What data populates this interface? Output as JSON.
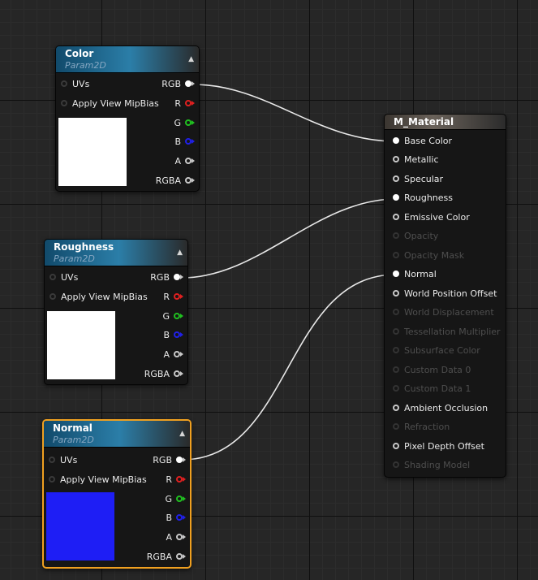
{
  "texture_nodes": [
    {
      "id": "color",
      "title": "Color",
      "subtitle": "Param2D",
      "preview_color": "#ffffff",
      "inputs": [
        "UVs",
        "Apply View MipBias"
      ],
      "outputs": [
        "RGB",
        "R",
        "G",
        "B",
        "A",
        "RGBA"
      ]
    },
    {
      "id": "roughness",
      "title": "Roughness",
      "subtitle": "Param2D",
      "preview_color": "#ffffff",
      "inputs": [
        "UVs",
        "Apply View MipBias"
      ],
      "outputs": [
        "RGB",
        "R",
        "G",
        "B",
        "A",
        "RGBA"
      ]
    },
    {
      "id": "normal",
      "title": "Normal",
      "subtitle": "Param2D",
      "preview_color": "#1e1ef5",
      "selected": true,
      "inputs": [
        "UVs",
        "Apply View MipBias"
      ],
      "outputs": [
        "RGB",
        "R",
        "G",
        "B",
        "A",
        "RGBA"
      ]
    }
  ],
  "material": {
    "title": "M_Material",
    "pins": [
      {
        "label": "Base Color",
        "enabled": true,
        "connected": true
      },
      {
        "label": "Metallic",
        "enabled": true,
        "connected": false
      },
      {
        "label": "Specular",
        "enabled": true,
        "connected": false
      },
      {
        "label": "Roughness",
        "enabled": true,
        "connected": true
      },
      {
        "label": "Emissive Color",
        "enabled": true,
        "connected": false
      },
      {
        "label": "Opacity",
        "enabled": false,
        "connected": false
      },
      {
        "label": "Opacity Mask",
        "enabled": false,
        "connected": false
      },
      {
        "label": "Normal",
        "enabled": true,
        "connected": true
      },
      {
        "label": "World Position Offset",
        "enabled": true,
        "connected": false
      },
      {
        "label": "World Displacement",
        "enabled": false,
        "connected": false
      },
      {
        "label": "Tessellation Multiplier",
        "enabled": false,
        "connected": false
      },
      {
        "label": "Subsurface Color",
        "enabled": false,
        "connected": false
      },
      {
        "label": "Custom Data 0",
        "enabled": false,
        "connected": false
      },
      {
        "label": "Custom Data 1",
        "enabled": false,
        "connected": false
      },
      {
        "label": "Ambient Occlusion",
        "enabled": true,
        "connected": false
      },
      {
        "label": "Refraction",
        "enabled": false,
        "connected": false
      },
      {
        "label": "Pixel Depth Offset",
        "enabled": true,
        "connected": false
      },
      {
        "label": "Shading Model",
        "enabled": false,
        "connected": false
      }
    ]
  },
  "connections": [
    {
      "from": "color.RGB",
      "to": "Base Color"
    },
    {
      "from": "roughness.RGB",
      "to": "Roughness"
    },
    {
      "from": "normal.RGB",
      "to": "Normal"
    }
  ],
  "pin_colors": {
    "R": "#e02020",
    "G": "#20c020",
    "B": "#2020e8",
    "A": "#c8c8c8",
    "RGB": "#ffffff",
    "RGBA": "#c8c8c8"
  }
}
